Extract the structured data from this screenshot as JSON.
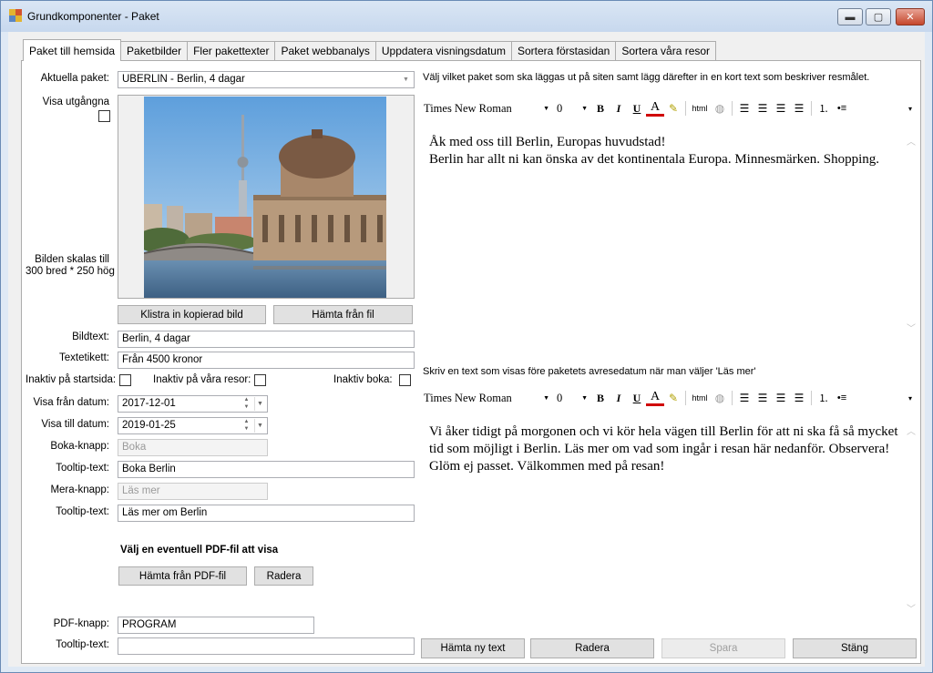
{
  "window": {
    "title": "Grundkomponenter - Paket",
    "min_glyph": "▬",
    "max_glyph": "▢",
    "close_glyph": "✕"
  },
  "tabs": [
    {
      "label": "Paket till hemsida",
      "active": true
    },
    {
      "label": "Paketbilder"
    },
    {
      "label": "Fler pakettexter"
    },
    {
      "label": "Paket webbanalys"
    },
    {
      "label": "Uppdatera visningsdatum"
    },
    {
      "label": "Sortera förstasidan"
    },
    {
      "label": "Sortera våra resor"
    }
  ],
  "left": {
    "aktuella_label": "Aktuella paket:",
    "aktuella_value": "UBERLIN - Berlin, 4 dagar",
    "visa_utgangna_label": "Visa utgångna",
    "scale_note_1": "Bilden skalas till",
    "scale_note_2": "300 bred * 250 hög",
    "paste_button": "Klistra in kopierad bild",
    "fetch_file_button": "Hämta från fil",
    "bildtext_label": "Bildtext:",
    "bildtext_value": "Berlin, 4 dagar",
    "textetikett_label": "Textetikett:",
    "textetikett_value": "Från 4500 kronor",
    "inaktiv_start_label": "Inaktiv på startsida:",
    "inaktiv_resor_label": "Inaktiv på våra resor:",
    "inaktiv_boka_label": "Inaktiv boka:",
    "visa_fran_label": "Visa från datum:",
    "visa_fran_value": "2017-12-01",
    "visa_till_label": "Visa till datum:",
    "visa_till_value": "2019-01-25",
    "boka_knapp_label": "Boka-knapp:",
    "boka_knapp_value": "Boka",
    "tooltip1_label": "Tooltip-text:",
    "tooltip1_value": "Boka Berlin",
    "mera_knapp_label": "Mera-knapp:",
    "mera_knapp_value": "Läs mer",
    "tooltip2_label": "Tooltip-text:",
    "tooltip2_value": "Läs mer om Berlin",
    "pdf_heading": "Välj en eventuell PDF-fil att visa",
    "pdf_fetch_button": "Hämta från PDF-fil",
    "pdf_delete_button": "Radera",
    "pdf_knapp_label": "PDF-knapp:",
    "pdf_knapp_value": "PROGRAM",
    "tooltip3_label": "Tooltip-text:",
    "tooltip3_value": ""
  },
  "right": {
    "prompt1": "Välj vilket paket som ska läggas ut på siten samt lägg därefter in en kort text som beskriver resmålet.",
    "prompt2": "Skriv en text som visas före paketets avresedatum när man väljer 'Läs mer'",
    "toolbar": {
      "font": "Times New Roman",
      "size": "0",
      "bold": "B",
      "italic": "I",
      "underline": "U",
      "font_color": "A",
      "html": "html"
    },
    "editor1_line1": "Åk med oss till Berlin, Europas huvudstad!",
    "editor1_line2": "Berlin har allt ni kan önska av det kontinentala Europa. Minnesmärken. Shopping.",
    "editor2_text": "Vi åker tidigt på morgonen och vi kör hela vägen till Berlin för att ni ska få så mycket tid som möjligt i Berlin. Läs mer om vad som ingår i resan här nedanför. Observera! Glöm ej passet. Välkommen med på resan!"
  },
  "bottom": {
    "fetch_text_button": "Hämta ny text",
    "delete_button": "Radera",
    "save_button": "Spara",
    "close_button": "Stäng"
  },
  "colors": {
    "title_bg": "#c7d8ee",
    "close_red": "#c5472c",
    "font_color_red": "#d00000",
    "highlight_yellow": "#f7e000"
  }
}
